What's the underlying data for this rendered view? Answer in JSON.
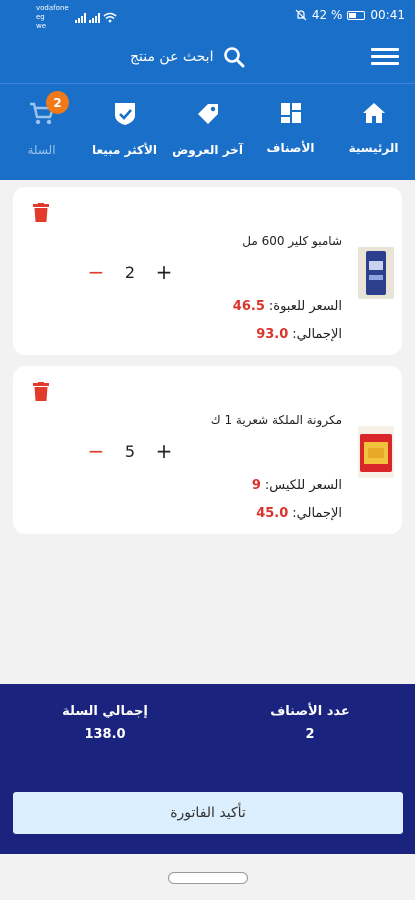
{
  "status_bar": {
    "carrier": "vodafone eg",
    "carrier2": "we",
    "battery": "42 %",
    "time": "00:41"
  },
  "header": {
    "search_placeholder": "ابحث عن منتج"
  },
  "nav": [
    {
      "label": "الرئيسية"
    },
    {
      "label": "الأصناف"
    },
    {
      "label": "آخر العروض"
    },
    {
      "label": "الأكثر مبيعا"
    },
    {
      "label": "السلة",
      "badge": "2"
    }
  ],
  "cart_items": [
    {
      "name": "شامبو كلير 600 مل",
      "quantity": "2",
      "price_label": "السعر للعبوة:",
      "price": "46.5",
      "total_label": "الإجمالي:",
      "total": "93.0"
    },
    {
      "name": "مكرونة الملكة شعرية 1 ك",
      "quantity": "5",
      "price_label": "السعر للكيس:",
      "price": "9",
      "total_label": "الإجمالي:",
      "total": "45.0"
    }
  ],
  "summary": {
    "items_count_label": "عدد الأصناف",
    "items_count": "2",
    "cart_total_label": "إجمالي السلة",
    "cart_total": "138.0",
    "confirm_label": "تأكيد الفاتورة"
  },
  "colors": {
    "primary": "#1a6fc9",
    "summary_bg": "#1a237e",
    "accent_red": "#d9342b",
    "badge": "#f07a1a"
  }
}
